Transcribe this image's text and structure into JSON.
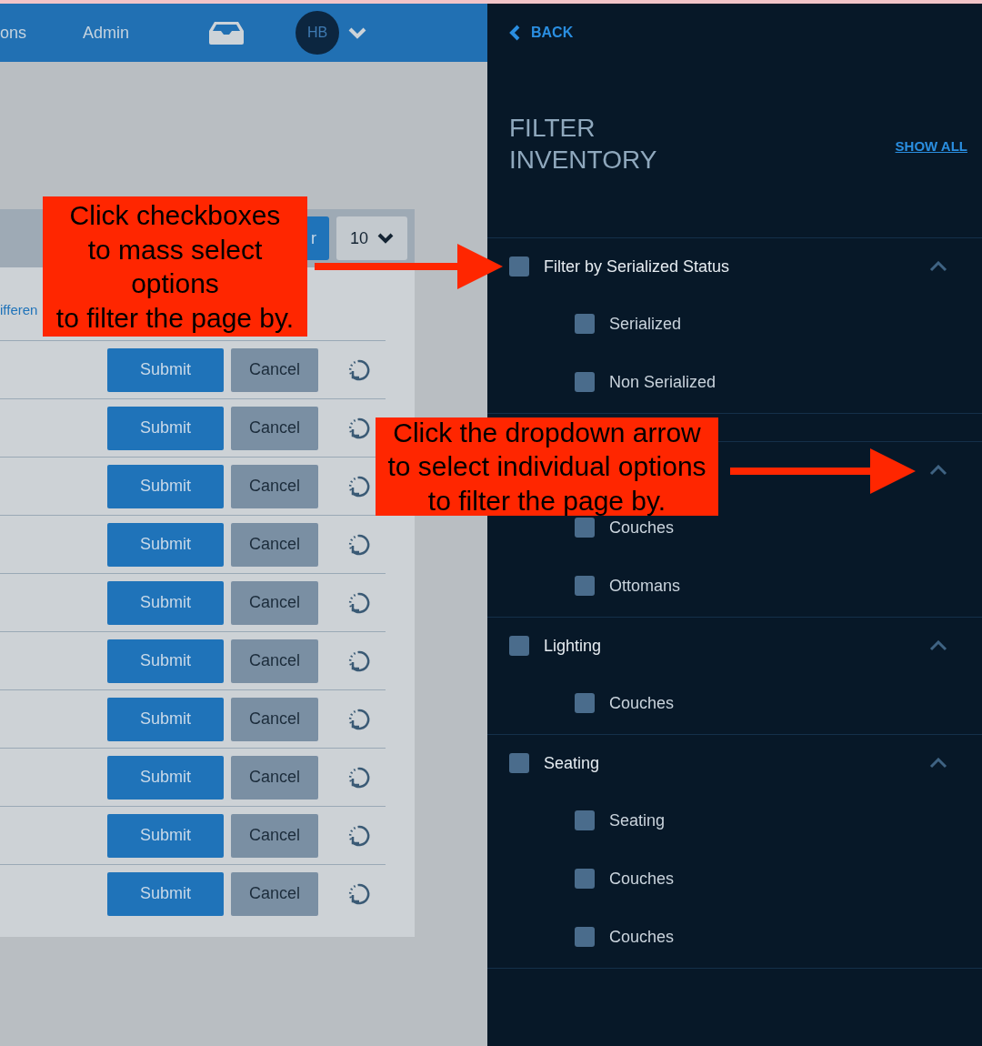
{
  "top_nav": {
    "items": [
      {
        "label": "ons"
      },
      {
        "label": "Admin"
      }
    ],
    "avatar": "HB"
  },
  "toolbar": {
    "button": "r",
    "page_size": "10"
  },
  "link_text": "ifferen",
  "rows": [
    {
      "submit": "Submit",
      "cancel": "Cancel"
    },
    {
      "submit": "Submit",
      "cancel": "Cancel"
    },
    {
      "submit": "Submit",
      "cancel": "Cancel"
    },
    {
      "submit": "Submit",
      "cancel": "Cancel"
    },
    {
      "submit": "Submit",
      "cancel": "Cancel"
    },
    {
      "submit": "Submit",
      "cancel": "Cancel"
    },
    {
      "submit": "Submit",
      "cancel": "Cancel"
    },
    {
      "submit": "Submit",
      "cancel": "Cancel"
    },
    {
      "submit": "Submit",
      "cancel": "Cancel"
    },
    {
      "submit": "Submit",
      "cancel": "Cancel"
    }
  ],
  "filter_panel": {
    "back": "BACK",
    "title": "FILTER INVENTORY",
    "show_all": "SHOW ALL",
    "groups": [
      {
        "label": "Filter by Serialized Status",
        "checked": false,
        "expanded": true,
        "options": [
          {
            "label": "Serialized",
            "checked": false
          },
          {
            "label": "Non Serialized",
            "checked": false
          }
        ]
      },
      {
        "expanded": true,
        "options": [
          {
            "label": "Couches",
            "checked": false
          },
          {
            "label": "Ottomans",
            "checked": false
          }
        ]
      },
      {
        "label": "Lighting",
        "checked": false,
        "expanded": true,
        "options": [
          {
            "label": "Couches",
            "checked": false
          }
        ]
      },
      {
        "label": "Seating",
        "checked": false,
        "expanded": true,
        "options": [
          {
            "label": "Seating",
            "checked": false
          },
          {
            "label": "Couches",
            "checked": false
          },
          {
            "label": "Couches",
            "checked": false
          }
        ]
      }
    ]
  },
  "annotations": [
    {
      "text": "Click checkboxes\nto mass select\noptions\nto filter the page by."
    },
    {
      "text": "Click the dropdown arrow\nto select individual options\nto filter the page by."
    }
  ]
}
